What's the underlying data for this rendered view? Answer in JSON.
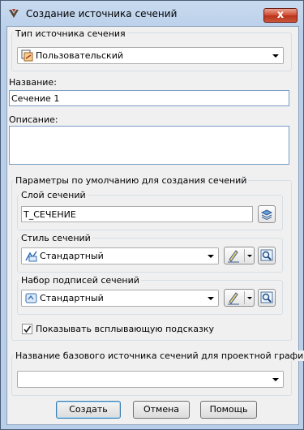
{
  "window": {
    "title": "Создание источника сечений",
    "close_label": "x"
  },
  "source_type": {
    "label": "Тип источника сечения",
    "value": "Пользовательский"
  },
  "name": {
    "label": "Название:",
    "value": "Сечение 1"
  },
  "description": {
    "label": "Описание:",
    "value": ""
  },
  "defaults": {
    "label": "Параметры по умолчанию для создания сечений",
    "layer": {
      "label": "Слой сечений",
      "value": "T_СЕЧЕНИЕ"
    },
    "style": {
      "label": "Стиль сечений",
      "value": "Стандартный"
    },
    "label_set": {
      "label": "Набор подписей сечений",
      "value": "Стандартный"
    },
    "tooltip": {
      "label": "Показывать всплывающую подсказку",
      "checked": true
    }
  },
  "base_source": {
    "label": "Название базового источника сечений для проектной графики",
    "value": ""
  },
  "buttons": {
    "create": "Создать",
    "cancel": "Отмена",
    "help": "Помощь"
  }
}
